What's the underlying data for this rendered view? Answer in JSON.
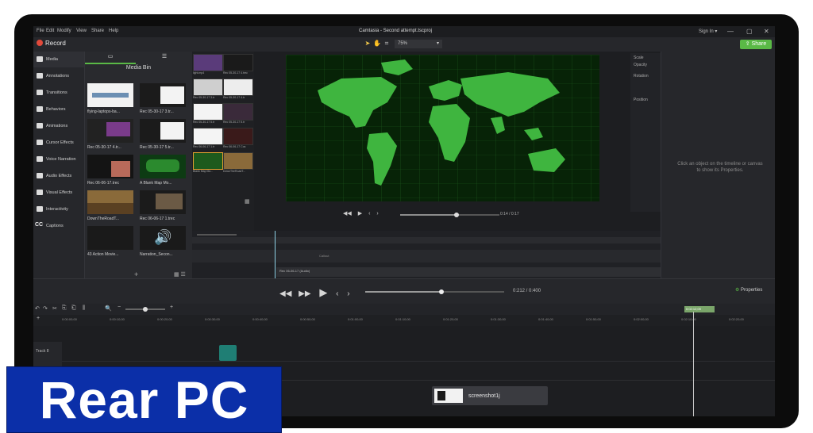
{
  "menu": [
    "File",
    "Edit",
    "Modify",
    "View",
    "Share",
    "Help"
  ],
  "window_title": "Camtasia - Second attempt.tscproj",
  "signin": "Sign In ▾",
  "record_label": "Record",
  "zoom_value": "75%",
  "share_label": "Share",
  "nav_items": [
    "Media",
    "Annotations",
    "Transitions",
    "Behaviors",
    "Animations",
    "Cursor Effects",
    "Voice Narration",
    "Audio Effects",
    "Visual Effects",
    "Interactivity",
    "Captions"
  ],
  "captions_icon_text": "CC",
  "media_bin_title": "Media Bin",
  "media_items": [
    "flying-laptops-ba...",
    "Rec 05-30-17 3.tr...",
    "Rec 05-30-17 4.tr...",
    "Rec 05-30-17 5.tr...",
    "Rec 06-06-17.trec",
    "A Blank Map Mo...",
    "DownTheRoadT...",
    "Rec 06-06-17 1.trec",
    "43 Action Movie...",
    "Narration_Secon..."
  ],
  "strip_items": [
    "light.mp4",
    "Rec 05-30-17 4.trec",
    "Rec 05-30-17 3.tr",
    "Rec 05-30-17 4.tr",
    "Rec 05-30-17 5.tr",
    "Rec 05-30-17 5.tr",
    "Rec 06-06-17 1.tr",
    "Rec 06-06-17 Cos",
    "Blank Map Mo...",
    "DownTheRoadT..."
  ],
  "preview_time": "0:14 / 0:17",
  "props_labels": [
    "Scale",
    "Opacity",
    "Rotation",
    "Position"
  ],
  "properties_hint": "Click an object on the timeline or canvas to show its Properties.",
  "main_time": "0:212 / 0:400",
  "properties_button": "Properties",
  "playhead_time": "0:02:12;09",
  "ruler_ticks": [
    "0:00:00;00",
    "0:00:10;00",
    "0:00:20;00",
    "0:00:30;00",
    "0:00:40;00",
    "0:00:50;00",
    "0:01:00;00",
    "0:01:10;00",
    "0:01:20;00",
    "0:01:30;00",
    "0:01:40;00",
    "0:01:50;00",
    "0:02:00;00",
    "0:02:10;00",
    "0:02:20;00"
  ],
  "track_label": "Track 8",
  "clip_label": "screenshot1j",
  "sub_clip_label": "Rec 06-06-17 (Audio)",
  "callout_label": "Callout",
  "banner_text": "Rear PC",
  "colors": {
    "accent": "#5ab946",
    "record": "#e24a3b",
    "banner": "#0b2fa8",
    "playhead": "#8fd1e6"
  }
}
